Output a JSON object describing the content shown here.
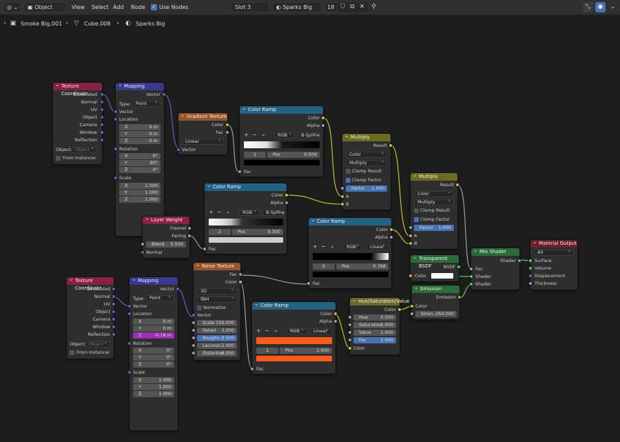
{
  "header": {
    "mode": "Object",
    "menus": [
      "View",
      "Select",
      "Add",
      "Node"
    ],
    "use_nodes": "Use Nodes",
    "slot": "Slot 3",
    "material": "Sparks Big",
    "users": "18"
  },
  "breadcrumb": {
    "object": "Smoke Big.001",
    "mesh": "Cube.008",
    "material": "Sparks Big"
  },
  "nodes": {
    "texcoord1": {
      "title": "Texture Coordinate",
      "outputs": [
        "Generated",
        "Normal",
        "UV",
        "Object",
        "Camera",
        "Window",
        "Reflection"
      ],
      "object_label": "Object:",
      "object_ph": "Object",
      "from_instancer": "From Instancer"
    },
    "mapping1": {
      "title": "Mapping",
      "out": "Vector",
      "type_label": "Type:",
      "type": "Point",
      "vector": "Vector",
      "location": "Location",
      "loc": [
        "0 m",
        "0 m",
        "0 m"
      ],
      "rotation": "Rotation",
      "rot": [
        "0°",
        "90°",
        "0°"
      ],
      "scale": "Scale",
      "scl": [
        "1.000",
        "1.000",
        "1.000"
      ]
    },
    "gradient": {
      "title": "Gradient Texture",
      "outputs": [
        "Color",
        "Fac"
      ],
      "type": "Linear",
      "input": "Vector"
    },
    "ramp1": {
      "title": "Color Ramp",
      "outputs": [
        "Color",
        "Alpha"
      ],
      "mode": "RGB",
      "interp": "B-Spline",
      "index": "1",
      "pos_label": "Pos",
      "pos": "0.509",
      "input": "Fac"
    },
    "ramp2": {
      "title": "Color Ramp",
      "outputs": [
        "Color",
        "Alpha"
      ],
      "mode": "RGB",
      "interp": "B-Spline",
      "index": "2",
      "pos_label": "Pos",
      "pos": "0.300",
      "input": "Fac"
    },
    "ramp3": {
      "title": "Color Ramp",
      "outputs": [
        "Color",
        "Alpha"
      ],
      "mode": "RGB",
      "interp": "Linear",
      "index": "0",
      "pos_label": "Pos",
      "pos": "0.768",
      "input": "Fac"
    },
    "ramp4": {
      "title": "Color Ramp",
      "outputs": [
        "Color",
        "Alpha"
      ],
      "mode": "RGB",
      "interp": "Linear",
      "index": "1",
      "pos_label": "Pos",
      "pos": "1.000",
      "input": "Fac"
    },
    "multiply1": {
      "title": "Multiply",
      "out": "Result",
      "type": "Color",
      "op": "Multiply",
      "clamp_result": "Clamp Result",
      "clamp_factor": "Clamp Factor",
      "factor_label": "Factor",
      "factor": "1.000",
      "a": "A",
      "b": "B"
    },
    "multiply2": {
      "title": "Multiply",
      "out": "Result",
      "type": "Color",
      "op": "Multiply",
      "clamp_result": "Clamp Result",
      "clamp_factor": "Clamp Factor",
      "factor_label": "Factor",
      "factor": "1.000",
      "a": "A",
      "b": "B"
    },
    "layerweight": {
      "title": "Layer Weight",
      "outputs": [
        "Fresnel",
        "Facing"
      ],
      "blend_label": "Blend",
      "blend": "0.500",
      "normal": "Normal"
    },
    "noise": {
      "title": "Noise Texture",
      "outputs": [
        "Fac",
        "Color"
      ],
      "dim": "3D",
      "basis": "fBM",
      "normalize": "Normalize",
      "vector": "Vector",
      "fields": [
        [
          "Scale",
          "150.000"
        ],
        [
          "Detail",
          "3.000"
        ],
        [
          "Roughn...",
          "0.500"
        ],
        [
          "Lacunar...",
          "2.000"
        ],
        [
          "Distortion",
          "0.000"
        ]
      ]
    },
    "texcoord2": {
      "title": "Texture Coordinate",
      "outputs": [
        "Generated",
        "Normal",
        "UV",
        "Object",
        "Camera",
        "Window",
        "Reflection"
      ],
      "object_label": "Object:",
      "object_ph": "Object",
      "from_instancer": "From Instancer"
    },
    "mapping2": {
      "title": "Mapping",
      "out": "Vector",
      "type_label": "Type:",
      "type": "Point",
      "vector": "Vector",
      "location": "Location",
      "loc": [
        "0 m",
        "0 m",
        "-0.18 m"
      ],
      "rotation": "Rotation",
      "rot": [
        "0°",
        "0°",
        "0°"
      ],
      "scale": "Scale",
      "scl": [
        "1.000",
        "1.000",
        "1.000"
      ]
    },
    "hsv": {
      "title": "Hue/Saturation/Value",
      "out": "Color",
      "fields": [
        [
          "Hue",
          "0.500"
        ],
        [
          "Saturation",
          "1.000"
        ],
        [
          "Value",
          "1.000"
        ],
        [
          "Fac",
          "1.000"
        ]
      ],
      "input": "Color"
    },
    "transparent": {
      "title": "Transparent BSDF",
      "out": "BSDF",
      "input": "Color"
    },
    "emission": {
      "title": "Emission",
      "out": "Emission",
      "color": "Color",
      "strength_label": "Stren...",
      "strength": "250.000"
    },
    "mixshader": {
      "title": "Mix Shader",
      "out": "Shader",
      "inputs": [
        "Fac",
        "Shader",
        "Shader"
      ]
    },
    "output": {
      "title": "Material Output",
      "target": "All",
      "inputs": [
        "Surface",
        "Volume",
        "Displacement",
        "Thickness"
      ]
    }
  },
  "xyz": [
    "X",
    "Y",
    "Z"
  ],
  "colors": {
    "accent": "#4772b3",
    "yellow": "#c7c729",
    "grey": "#a1a1a1",
    "purple": "#6363c7",
    "green": "#63c763",
    "orange": "#ff5a1a"
  }
}
